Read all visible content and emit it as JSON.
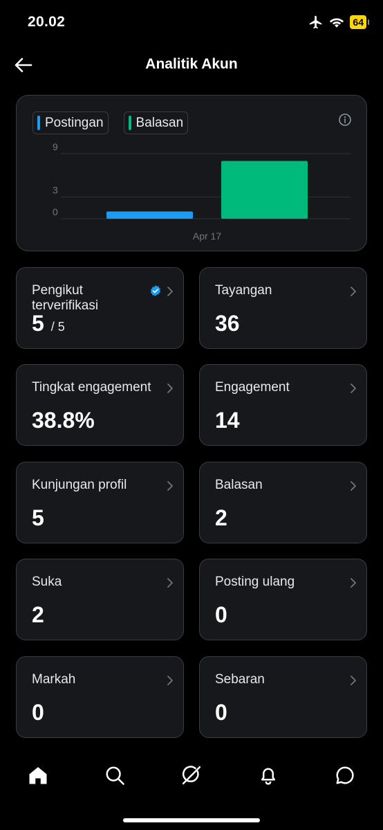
{
  "status_bar": {
    "time": "20.02",
    "battery": "64"
  },
  "header": {
    "title": "Analitik Akun"
  },
  "legend": [
    {
      "label": "Postingan",
      "color": "#1d9bf0"
    },
    {
      "label": "Balasan",
      "color": "#00ba7c"
    }
  ],
  "chart_data": {
    "type": "bar",
    "categories": [
      "Apr 17"
    ],
    "series": [
      {
        "name": "Postingan",
        "values": [
          1
        ],
        "color": "#1d9bf0"
      },
      {
        "name": "Balasan",
        "values": [
          8
        ],
        "color": "#00ba7c"
      }
    ],
    "y_ticks": [
      "0",
      "3",
      "9"
    ],
    "ylim": [
      0,
      9
    ],
    "grid": true,
    "legend_position": "top-left"
  },
  "stats": {
    "verified_followers": {
      "label": "Pengikut terverifikasi",
      "value": "5",
      "sub": "/ 5"
    },
    "impressions": {
      "label": "Tayangan",
      "value": "36"
    },
    "engagement_rate": {
      "label": "Tingkat engagement",
      "value": "38.8%"
    },
    "engagements": {
      "label": "Engagement",
      "value": "14"
    },
    "profile_visits": {
      "label": "Kunjungan profil",
      "value": "5"
    },
    "replies": {
      "label": "Balasan",
      "value": "2"
    },
    "likes": {
      "label": "Suka",
      "value": "2"
    },
    "reposts": {
      "label": "Posting ulang",
      "value": "0"
    },
    "bookmarks": {
      "label": "Markah",
      "value": "0"
    },
    "shares": {
      "label": "Sebaran",
      "value": "0"
    }
  },
  "nav": [
    "home-icon",
    "search-icon",
    "grok-icon",
    "bell-icon",
    "messages-icon"
  ]
}
